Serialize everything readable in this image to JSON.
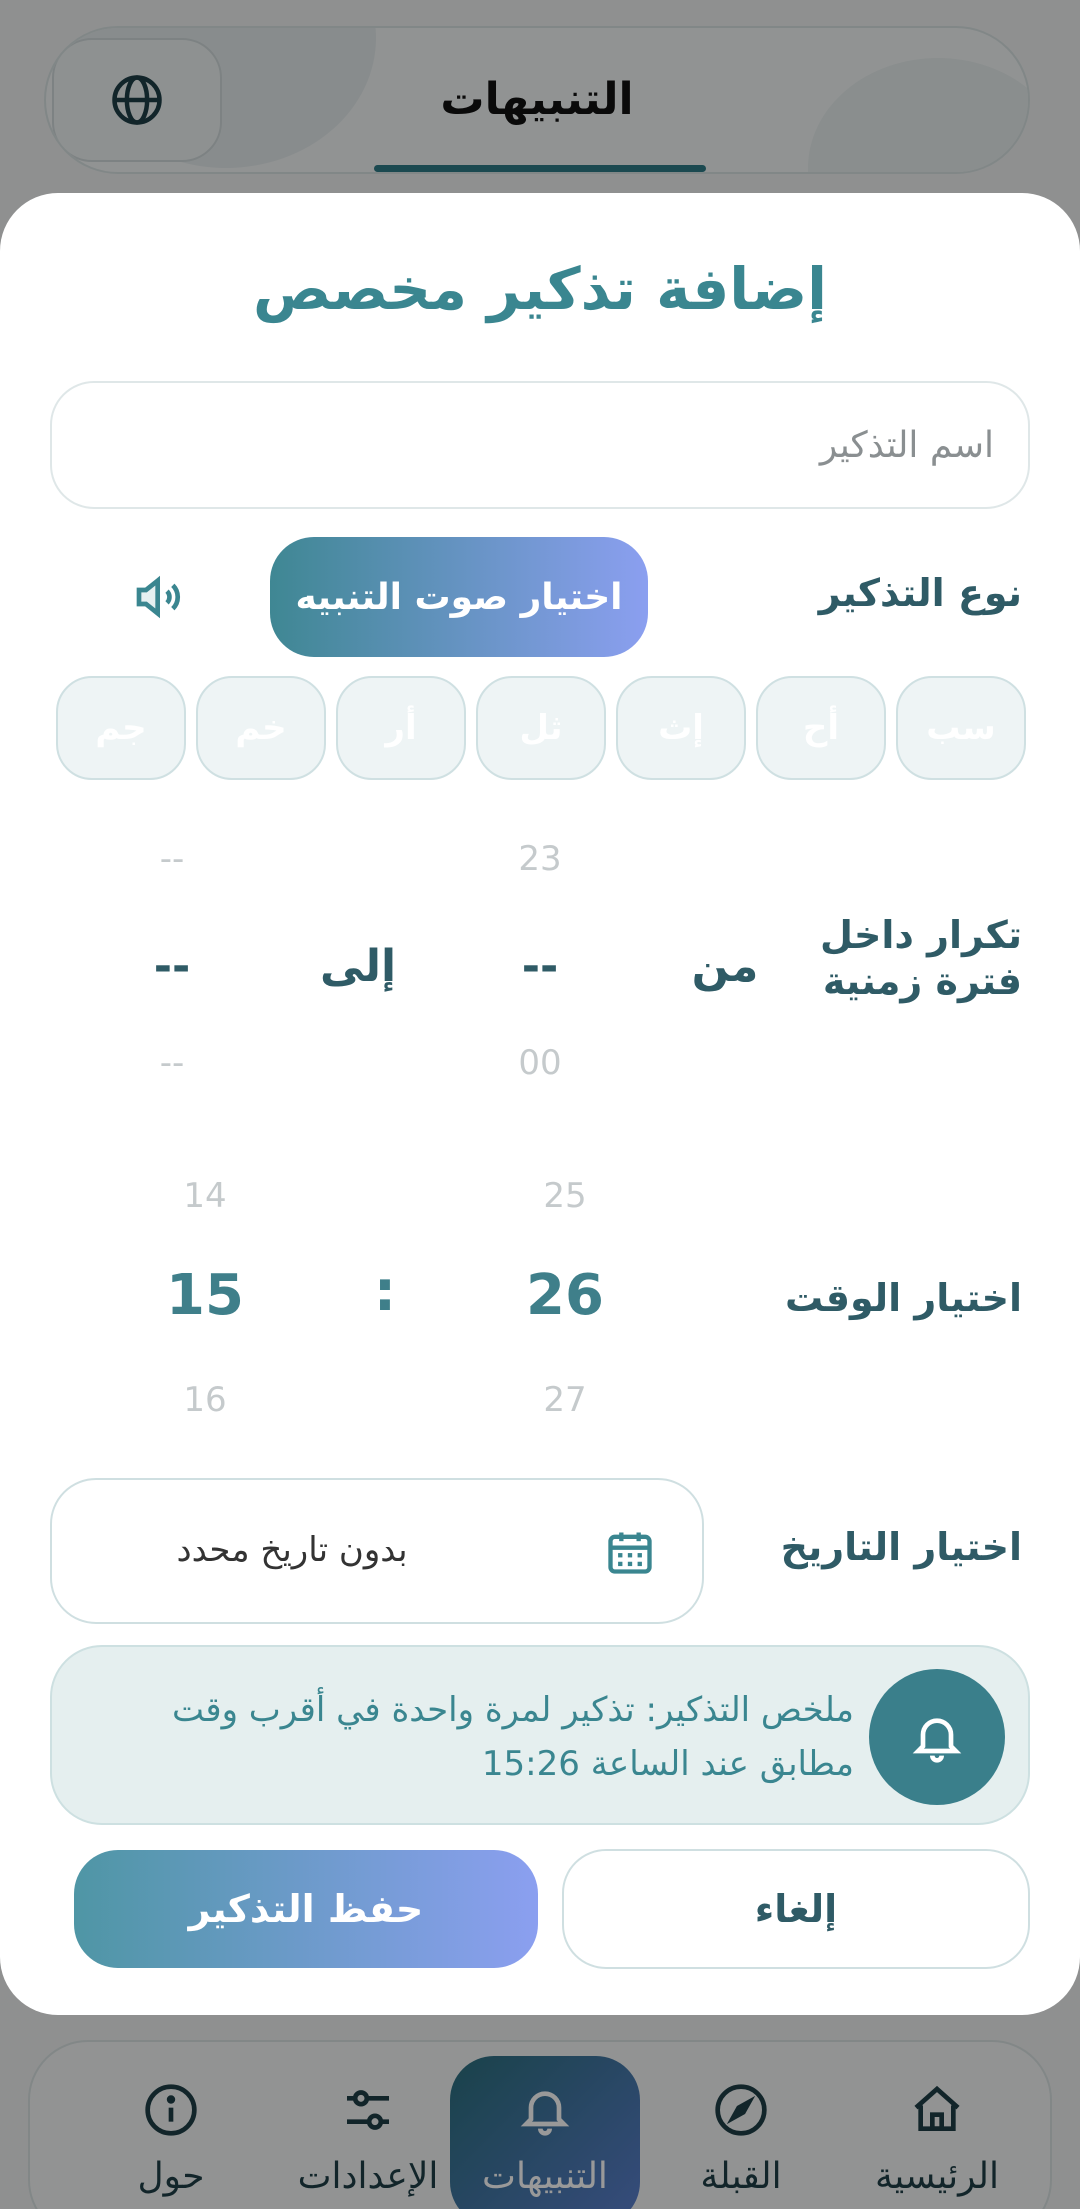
{
  "header": {
    "title": "التنبيهات",
    "icon": "globe-icon"
  },
  "nav": {
    "items": [
      {
        "label": "حول",
        "icon": "info-icon"
      },
      {
        "label": "الإعدادات",
        "icon": "sliders-icon"
      },
      {
        "label": "التنبيهات",
        "icon": "bell-icon",
        "active": true
      },
      {
        "label": "القبلة",
        "icon": "compass-icon"
      },
      {
        "label": "الرئيسية",
        "icon": "home-icon"
      }
    ]
  },
  "modal": {
    "title": "إضافة تذكير مخصص",
    "name_placeholder": "اسم التذكير",
    "type_label": "نوع التذكير",
    "sound_button": "اختيار صوت التنبيه",
    "days": [
      "سب",
      "أح",
      "إث",
      "ثل",
      "أر",
      "خم",
      "جم"
    ],
    "repeat": {
      "label_line1": "تكرار داخل",
      "label_line2": "فترة زمنية",
      "from_label": "من",
      "to_label": "إلى",
      "from_value": "--",
      "from_prev": "23",
      "from_next": "00",
      "to_value": "--",
      "to_prev": "--",
      "to_next": "--"
    },
    "time": {
      "label": "اختيار الوقت",
      "separator": ":",
      "minute_prev": "25",
      "minute": "26",
      "minute_next": "27",
      "hour_prev": "14",
      "hour": "15",
      "hour_next": "16"
    },
    "date": {
      "label": "اختيار التاريخ",
      "value": "بدون تاريخ محدد"
    },
    "summary": {
      "line1": "ملخص التذكير: تذكير لمرة واحدة في أقرب وقت",
      "line2": "مطابق عند الساعة 15:26"
    },
    "save_button": "حفظ التذكير",
    "cancel_button": "إلغاء"
  },
  "colors": {
    "accent": "#3a8690",
    "gradient_start": "#3f8793",
    "gradient_end": "#8b9ff0"
  }
}
